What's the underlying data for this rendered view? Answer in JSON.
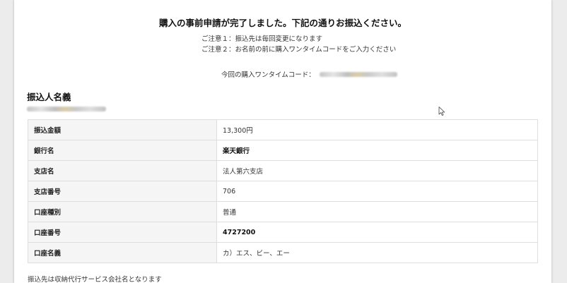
{
  "header": {
    "title": "購入の事前申請が完了しました。下記の通りお振込ください。",
    "notes": [
      "ご注意１：振込先は毎回変更になります",
      "ご注意２：お名前の前に購入ワンタイムコードをご入力ください"
    ],
    "otc_label": "今回の購入ワンタイムコード："
  },
  "payer": {
    "title": "振込人名義"
  },
  "bank_details": [
    {
      "label": "振込金額",
      "value": "13,300円",
      "emphasis": false
    },
    {
      "label": "銀行名",
      "value": "楽天銀行",
      "emphasis": true
    },
    {
      "label": "支店名",
      "value": "法人第六支店",
      "emphasis": false
    },
    {
      "label": "支店番号",
      "value": "706",
      "emphasis": false
    },
    {
      "label": "口座種別",
      "value": "普通",
      "emphasis": false
    },
    {
      "label": "口座番号",
      "value": "4727200",
      "emphasis": true
    },
    {
      "label": "口座名義",
      "value": "カ）エス、ビー、エー",
      "emphasis": false
    }
  ],
  "footer": {
    "note": "振込先は収納代行サービス会社名となります"
  },
  "icons": {
    "cursor": "mouse-pointer-icon"
  }
}
